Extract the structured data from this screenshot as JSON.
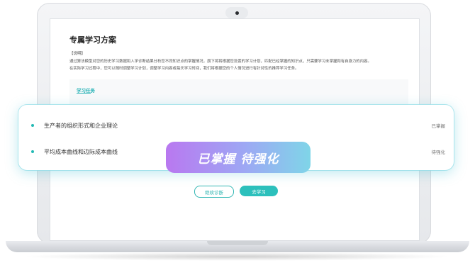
{
  "page": {
    "title": "专属学习方案",
    "note_heading": "【说明】",
    "note_lines": [
      "通过算法模型对您的历史学习数据和入学诊断结果分析您不同知识点的掌握情况，旗下将将根据您设置的学习计划，匹配已经掌握的知识点，只需要学习未掌握和有自身力的内容。",
      "在实际学习过程中，您可以随时调整学习计划，调整学习内容或每天学习时间，我们将根据您的个人情况进行有针对性的推荐学习任务。"
    ],
    "task_heading": "学习任务"
  },
  "tasks": [
    {
      "label": "生产者的组织形式和企业理论",
      "status": "已掌握"
    },
    {
      "label": "平均成本曲线和边际成本曲线",
      "status": "待强化"
    }
  ],
  "ribbon_text": "已掌握 待强化",
  "buttons": {
    "continue": "继续诊断",
    "study": "去学习"
  },
  "colors": {
    "accent": "#2cc0bc",
    "ribbon_start": "#b978f0",
    "ribbon_end": "#7fd5e8"
  }
}
